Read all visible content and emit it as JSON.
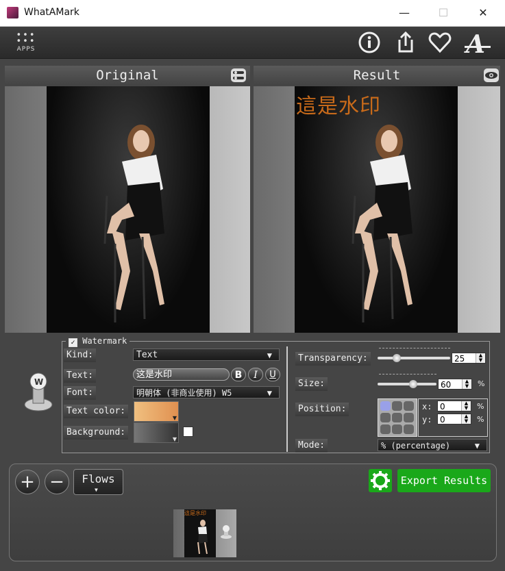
{
  "window": {
    "title": "WhatAMark",
    "minimize": "—",
    "maximize": "☐",
    "close": "✕"
  },
  "toolbar": {
    "apps_label": "APPS",
    "apps_dots": "•••\n•••"
  },
  "panels": {
    "original_title": "Original",
    "result_title": "Result",
    "watermark_text_overlay": "這是水印"
  },
  "watermark": {
    "section_label": "Watermark",
    "checked": true,
    "kind_label": "Kind:",
    "kind_value": "Text",
    "text_label": "Text:",
    "text_value": "这是水印",
    "bold": "B",
    "italic": "I",
    "underline": "U",
    "font_label": "Font:",
    "font_value": "明朝体 (非商业使用) W5",
    "text_color_label": "Text color:",
    "text_color": "#e8a060",
    "background_label": "Background:",
    "transparency_label": "Transparency:",
    "transparency_value": "25",
    "size_label": "Size:",
    "size_value": "60",
    "size_unit": "%",
    "position_label": "Position:",
    "x_label": "x:",
    "x_value": "0",
    "x_unit": "%",
    "y_label": "y:",
    "y_value": "0",
    "y_unit": "%",
    "mode_label": "Mode:",
    "mode_value": "% (percentage)"
  },
  "bottom": {
    "add": "+",
    "remove": "−",
    "flows_label": "Flows",
    "export_label": "Export Results",
    "thumb_overlay": "這是水印"
  },
  "colors": {
    "accent_green": "#1aa81a",
    "watermark_orange": "#c86a1a"
  }
}
